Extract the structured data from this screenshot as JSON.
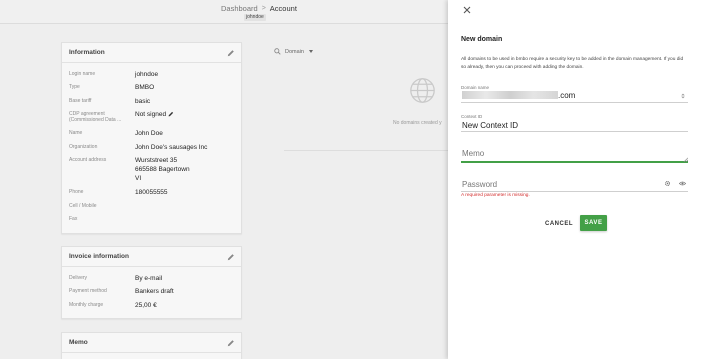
{
  "breadcrumb": {
    "parent": "Dashboard",
    "separator": ">",
    "current": "Account",
    "user_tag": "johndoe"
  },
  "information": {
    "title": "Information",
    "rows": [
      {
        "label": "Login name",
        "value": "johndoe"
      },
      {
        "label": "Type",
        "value": "BMBO"
      },
      {
        "label": "Base tariff",
        "value": "basic"
      },
      {
        "label": "CDP agreement (Commissioned Data ...",
        "value": "Not signed"
      },
      {
        "label": "Name",
        "value": "John Doe"
      },
      {
        "label": "Organization",
        "value": "John Doe's sausages Inc"
      },
      {
        "label": "Account address",
        "value": "Wurststreet 35",
        "value2": "665588 Bagertown",
        "value3": "VI"
      },
      {
        "label": "Phone",
        "value": "180055555"
      },
      {
        "label": "Cell / Mobile",
        "value": ""
      },
      {
        "label": "Fax",
        "value": ""
      }
    ]
  },
  "invoice": {
    "title": "Invoice information",
    "rows": [
      {
        "label": "Delivery",
        "value": "By e-mail"
      },
      {
        "label": "Payment method",
        "value": "Bankers draft"
      },
      {
        "label": "Monthly charge",
        "value": "25,00 €"
      }
    ]
  },
  "memo_card": {
    "title": "Memo"
  },
  "domains": {
    "filter_label": "Domain",
    "empty_message": "No domains created y"
  },
  "drawer": {
    "title": "New domain",
    "description": "All domains to be used in bmbo require a security key to be added in the domain management. If you did so already, then you can proceed with adding the domain.",
    "domain_label": "Domain name",
    "domain_suffix": ".com",
    "context_label": "Context ID",
    "context_value": "New Context ID",
    "memo_placeholder": "Memo",
    "password_placeholder": "Password",
    "error": "A required parameter is missing.",
    "cancel_label": "CANCEL",
    "save_label": "SAVE",
    "accent_color": "#43a047",
    "error_color": "#d32f2f"
  }
}
